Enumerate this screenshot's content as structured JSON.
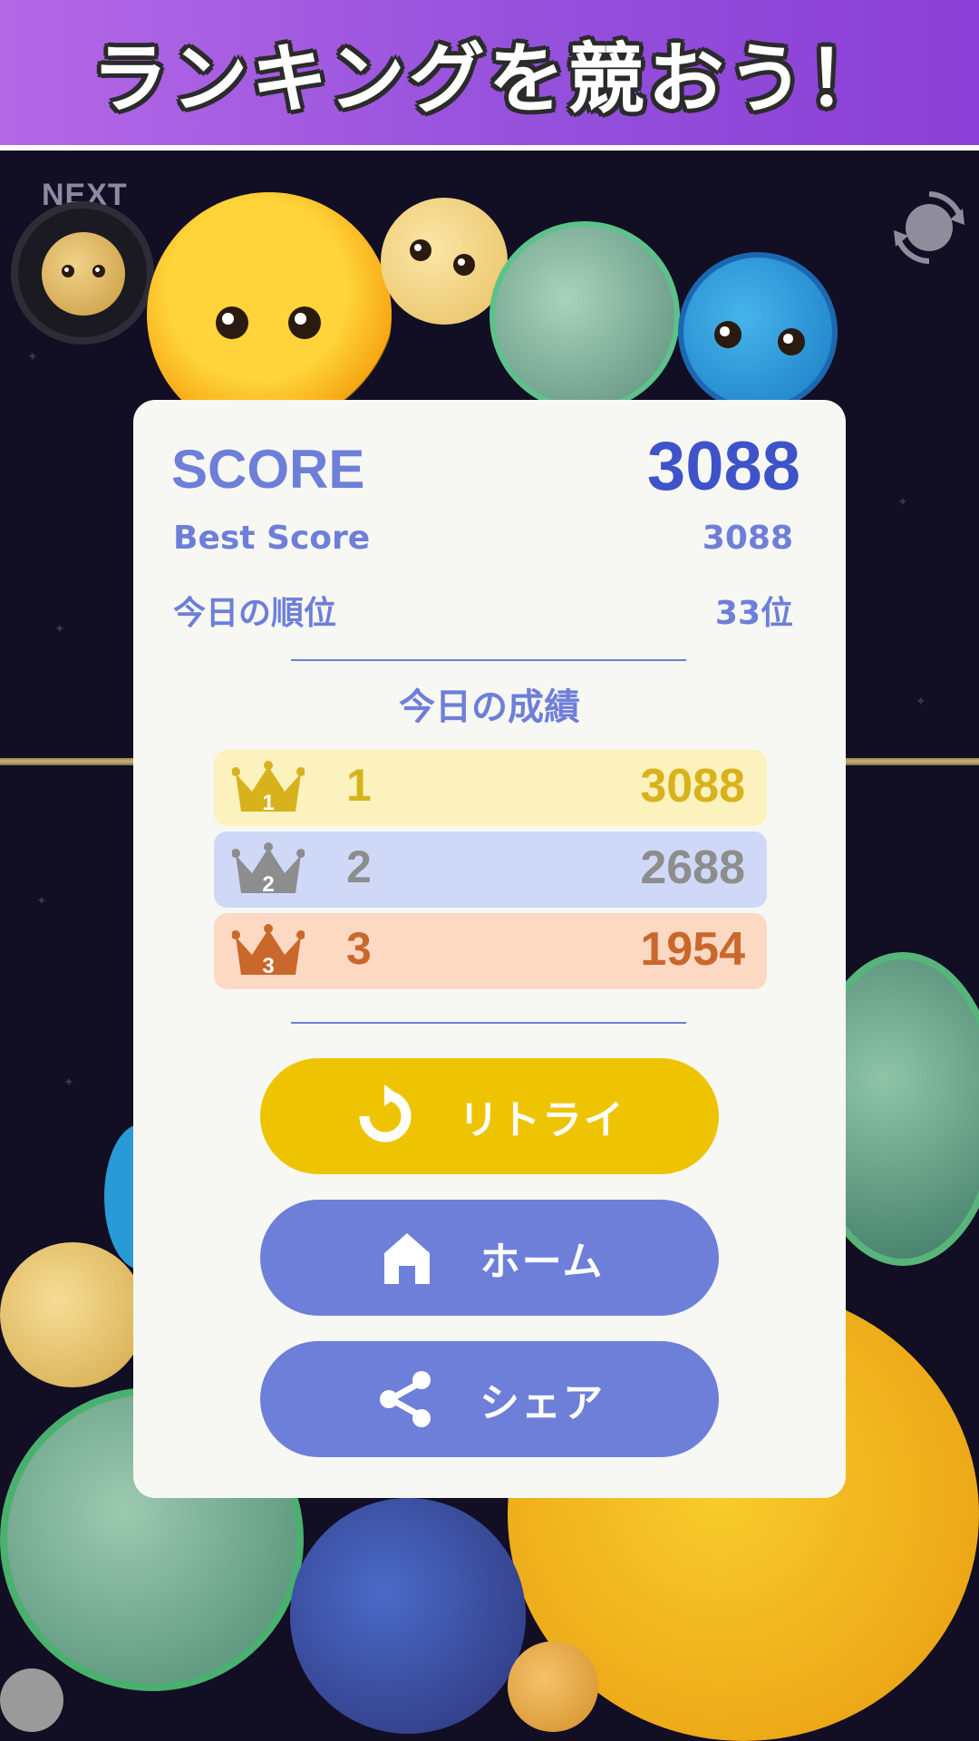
{
  "banner": {
    "title": "ランキングを競おう！"
  },
  "hud": {
    "next_label": "NEXT"
  },
  "result": {
    "score_label": "SCORE",
    "score_value": "3088",
    "best_label": "Best Score",
    "best_value": "3088",
    "rank_label": "今日の順位",
    "rank_value": "33位",
    "today_title": "今日の成績"
  },
  "ranking": [
    {
      "rank": "1",
      "score": "3088",
      "medal": "gold"
    },
    {
      "rank": "2",
      "score": "2688",
      "medal": "silver"
    },
    {
      "rank": "3",
      "score": "1954",
      "medal": "bronze"
    }
  ],
  "buttons": {
    "retry": "リトライ",
    "home": "ホーム",
    "share": "シェア"
  },
  "colors": {
    "accent": "#6e7fd9",
    "retry": "#eec402",
    "gold_bg": "#fbf2bd",
    "gold_text": "#d8b21c",
    "silver_bg": "#cfd9f7",
    "silver_text": "#8d8d8d",
    "bronze_bg": "#fdd9c4",
    "bronze_text": "#c9682a"
  },
  "icons": [
    "crown-icon",
    "retry-icon",
    "home-icon",
    "share-icon",
    "reload-icon"
  ]
}
